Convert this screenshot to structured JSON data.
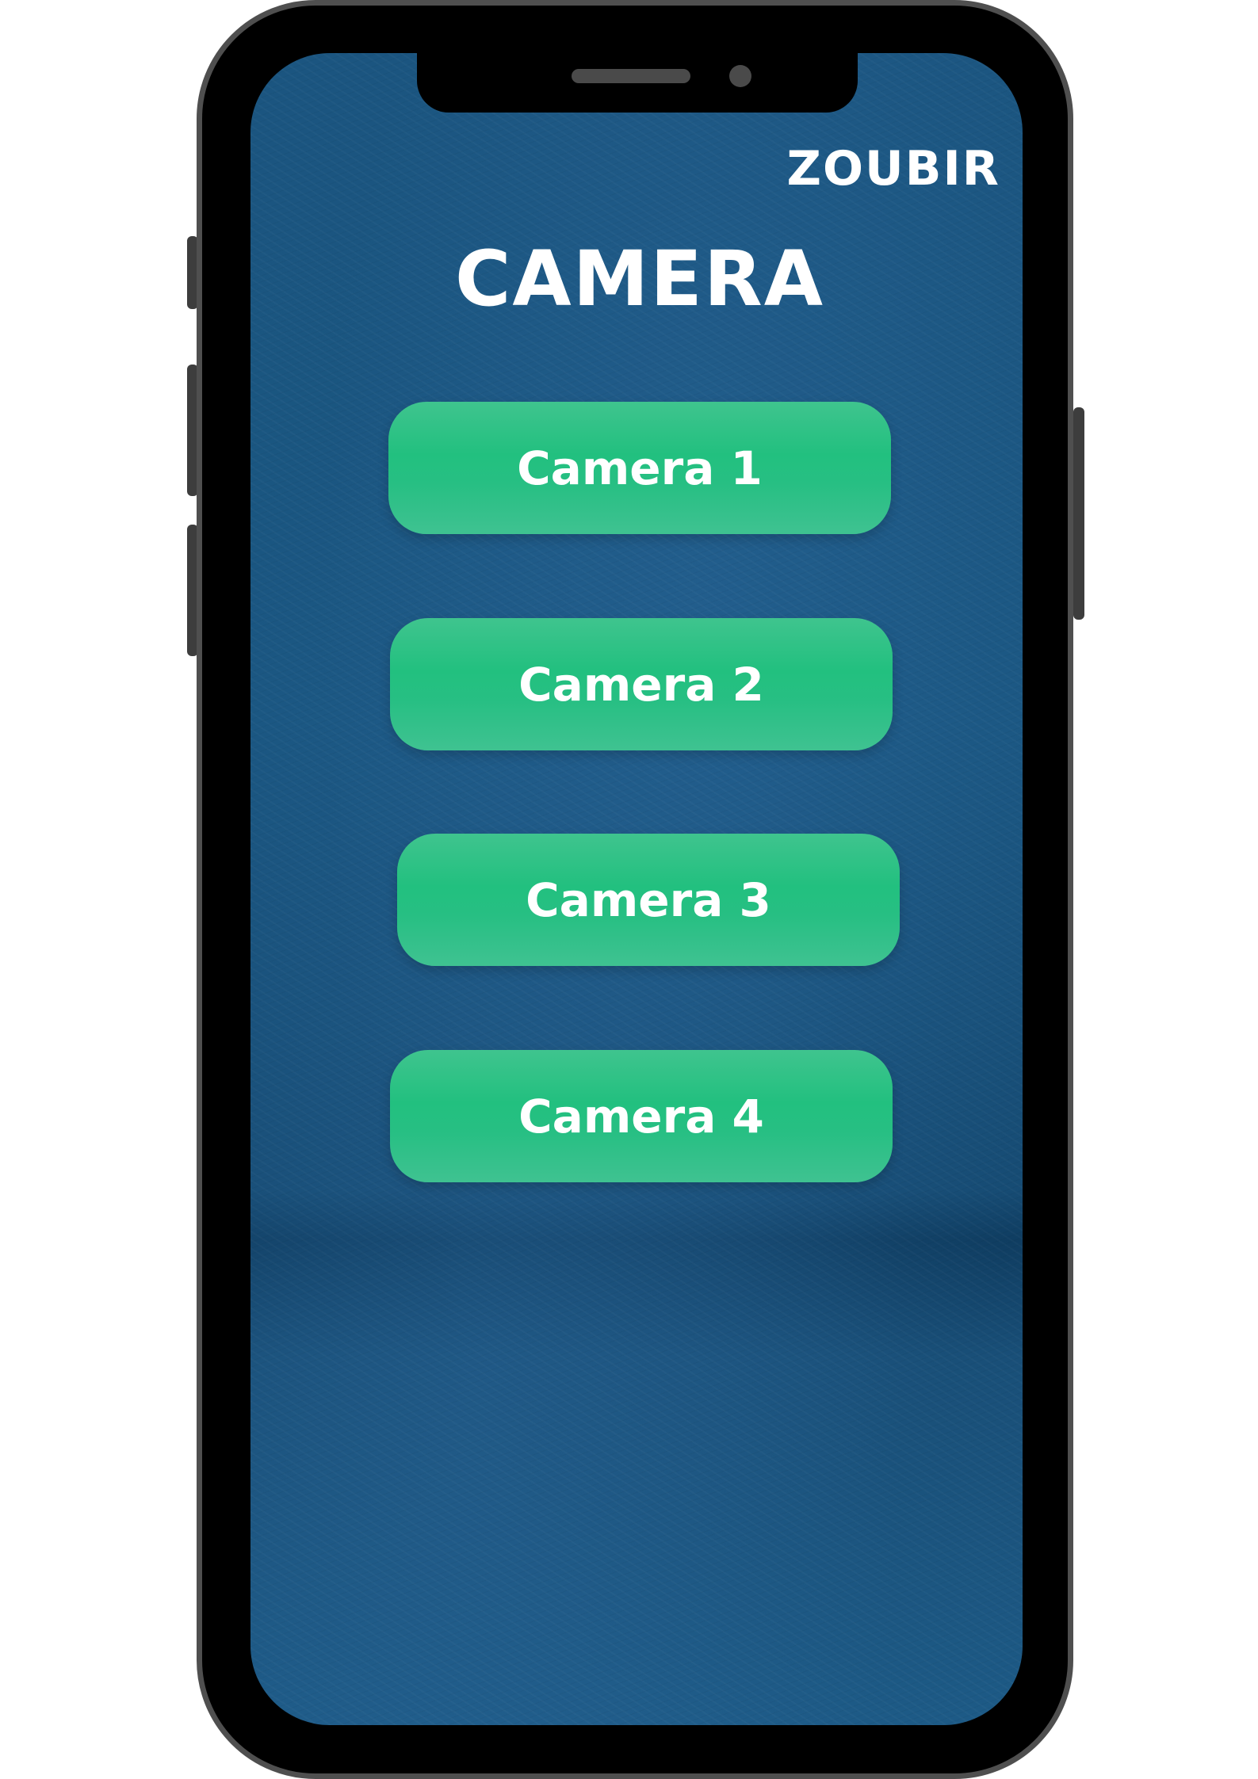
{
  "app": {
    "brand": "ZOUBIR",
    "title": "CAMERA"
  },
  "buttons": [
    {
      "label": "Camera 1"
    },
    {
      "label": "Camera 2"
    },
    {
      "label": "Camera 3"
    },
    {
      "label": "Camera 4"
    }
  ],
  "colors": {
    "screen_background": "#1b5580",
    "button_green": "#22c07f",
    "text": "#ffffff",
    "phone_frame": "#000000",
    "phone_bezel": "#4f4f4f"
  }
}
